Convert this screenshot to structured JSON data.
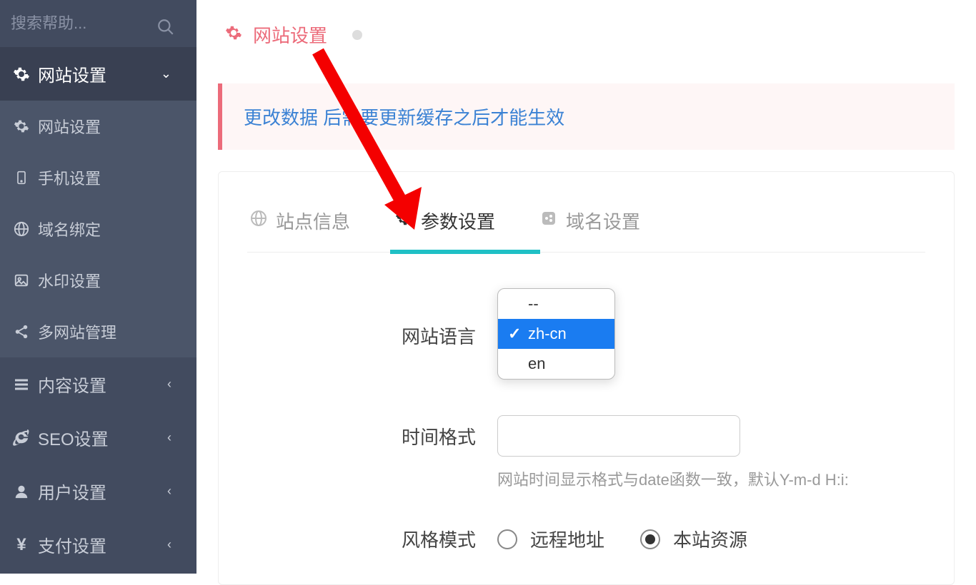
{
  "sidebar": {
    "search_placeholder": "搜索帮助...",
    "items": [
      {
        "label": "网站设置",
        "icon": "gear",
        "active": true,
        "expandable": true
      },
      {
        "label": "网站设置",
        "icon": "gear",
        "sub": true
      },
      {
        "label": "手机设置",
        "icon": "phone",
        "sub": true
      },
      {
        "label": "域名绑定",
        "icon": "globe",
        "sub": true
      },
      {
        "label": "水印设置",
        "icon": "image",
        "sub": true
      },
      {
        "label": "多网站管理",
        "icon": "share",
        "sub": true
      },
      {
        "label": "内容设置",
        "icon": "bars",
        "expandable": true
      },
      {
        "label": "SEO设置",
        "icon": "ie",
        "expandable": true
      },
      {
        "label": "用户设置",
        "icon": "user",
        "expandable": true
      },
      {
        "label": "支付设置",
        "icon": "yen",
        "expandable": true
      }
    ]
  },
  "breadcrumb": {
    "title": "网站设置"
  },
  "alert": {
    "text": "更改数据    后需要更新缓存之后才能生效"
  },
  "tabs": [
    {
      "label": "站点信息",
      "icon": "globe"
    },
    {
      "label": "参数设置",
      "icon": "gear",
      "active": true
    },
    {
      "label": "域名设置",
      "icon": "share"
    }
  ],
  "form": {
    "language_label": "网站语言",
    "time_format_label": "时间格式",
    "time_format_value": "",
    "time_format_hint": "网站时间显示格式与date函数一致，默认Y-m-d H:i:",
    "style_mode_label": "风格模式",
    "style_remote": "远程地址",
    "style_local": "本站资源"
  },
  "dropdown": {
    "options": [
      "--",
      "zh-cn",
      "en"
    ],
    "selected": "zh-cn"
  }
}
